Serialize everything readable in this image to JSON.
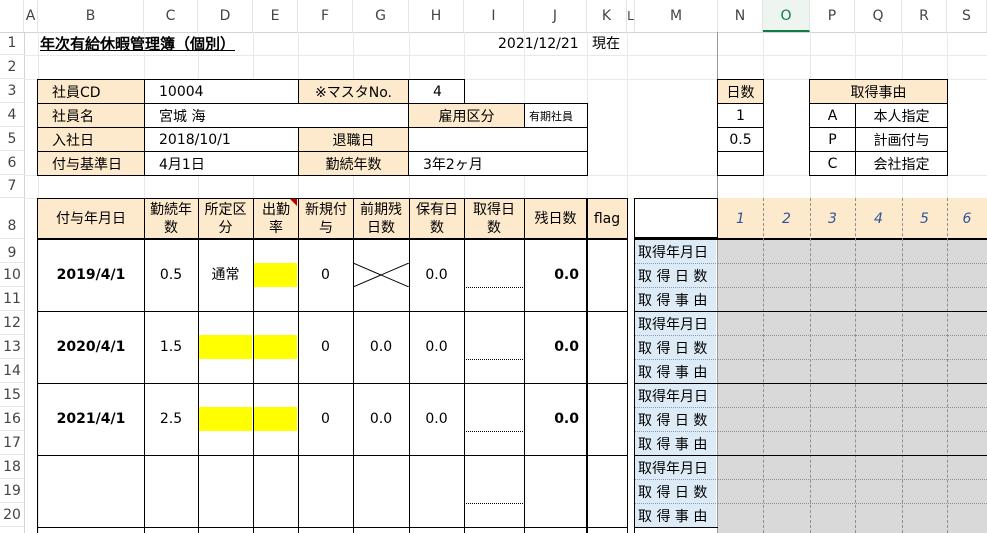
{
  "columns": [
    "A",
    "B",
    "C",
    "D",
    "E",
    "F",
    "G",
    "H",
    "I",
    "J",
    "K",
    "L",
    "M",
    "N",
    "O",
    "P",
    "Q",
    "R",
    "S"
  ],
  "rows": [
    "1",
    "2",
    "3",
    "4",
    "5",
    "6",
    "7",
    "8",
    "9",
    "10",
    "11",
    "12",
    "13",
    "14",
    "15",
    "16",
    "17",
    "18",
    "19",
    "20"
  ],
  "title": "年次有給休暇管理簿（個別）",
  "as_of_date": "2021/12/21",
  "as_of_suffix": "現在",
  "info": {
    "emp_cd_label": "社員CD",
    "emp_cd": "10004",
    "master_label": "※マスタNo.",
    "master_no": "4",
    "emp_name_label": "社員名",
    "emp_name": "宮城  海",
    "employment_label": "雇用区分",
    "employment": "有期社員",
    "join_label": "入社日",
    "join_date": "2018/10/1",
    "retire_label": "退職日",
    "retire_date": "",
    "base_label": "付与基準日",
    "base_date": "4月1日",
    "service_label": "勤続年数",
    "service_years": "3年2ヶ月"
  },
  "days_table": {
    "header": "日数",
    "values": [
      "1",
      "0.5",
      ""
    ]
  },
  "reason_table": {
    "header": "取得事由",
    "rows": [
      {
        "code": "A",
        "label": "本人指定"
      },
      {
        "code": "P",
        "label": "計画付与"
      },
      {
        "code": "C",
        "label": "会社指定"
      }
    ]
  },
  "main_headers": {
    "grant_date": "付与年月日",
    "service": "勤続年数",
    "category": "所定区分",
    "attendance": "出勤率",
    "new_grant": "新規付与",
    "prev_remaining": "前期残日数",
    "held_days": "保有日数",
    "taken_days": "取得日数",
    "remaining": "残日数",
    "flag": "flag"
  },
  "records": [
    {
      "grant_date": "2019/4/1",
      "service": "0.5",
      "category": "通常",
      "new_grant": "0",
      "prev_remaining": "",
      "held_days": "0.0",
      "remaining": "0.0"
    },
    {
      "grant_date": "2020/4/1",
      "service": "1.5",
      "category": "",
      "new_grant": "0",
      "prev_remaining": "0.0",
      "held_days": "0.0",
      "remaining": "0.0"
    },
    {
      "grant_date": "2021/4/1",
      "service": "2.5",
      "category": "",
      "new_grant": "0",
      "prev_remaining": "0.0",
      "held_days": "0.0",
      "remaining": "0.0"
    }
  ],
  "side_labels": [
    "取得年月日",
    "取 得 日 数",
    "取 得 事 由"
  ],
  "slot_numbers": [
    "1",
    "2",
    "3",
    "4",
    "5",
    "6"
  ],
  "colors": {
    "header_fill": "#fdeacd",
    "highlight": "#ffff00",
    "side_label_fill": "#ddebf7",
    "gray_fill": "#d9d9d9",
    "slot_header_fill": "#fdeacd",
    "slot_number_color": "#2f5597"
  }
}
